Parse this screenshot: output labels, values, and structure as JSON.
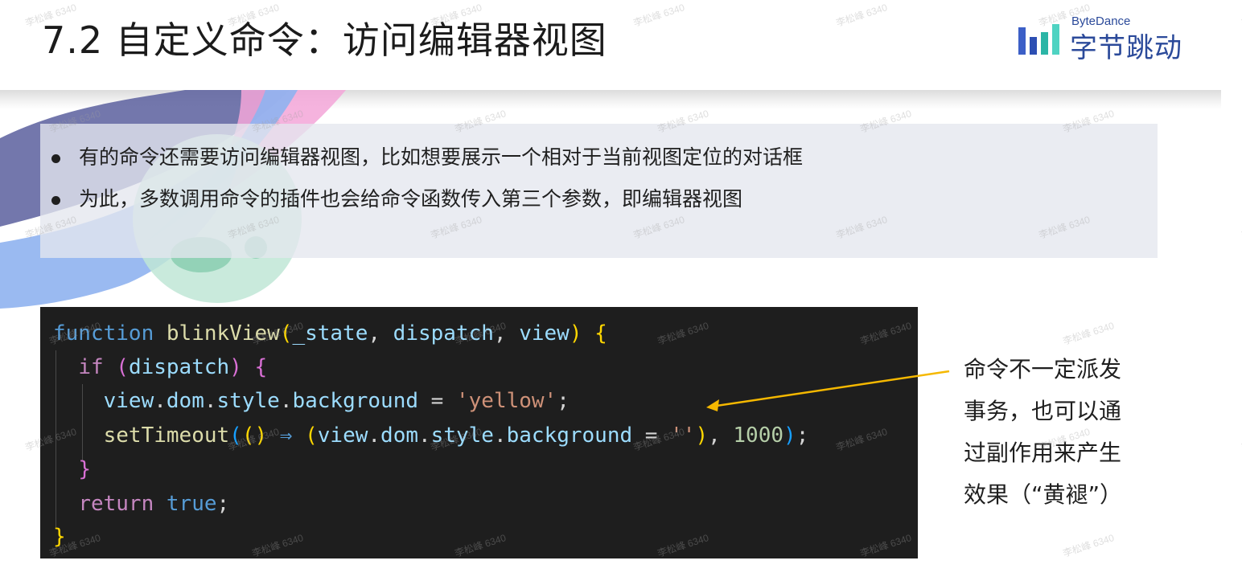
{
  "title": "7.2 自定义命令：访问编辑器视图",
  "logo": {
    "en": "ByteDance",
    "cn": "字节跳动"
  },
  "bullets": [
    "有的命令还需要访问编辑器视图，比如想要展示一个相对于当前视图定位的对话框",
    "为此，多数调用命令的插件也会给命令函数传入第三个参数，即编辑器视图"
  ],
  "code": {
    "lines": [
      [
        {
          "t": "function",
          "c": "kw"
        },
        {
          "t": " "
        },
        {
          "t": "blinkView",
          "c": "fn"
        },
        {
          "t": "(",
          "c": "br1"
        },
        {
          "t": "_state",
          "c": "var"
        },
        {
          "t": ", "
        },
        {
          "t": "dispatch",
          "c": "var"
        },
        {
          "t": ", "
        },
        {
          "t": "view",
          "c": "var"
        },
        {
          "t": ")",
          "c": "br1"
        },
        {
          "t": " "
        },
        {
          "t": "{",
          "c": "br1"
        }
      ],
      [
        {
          "t": "  "
        },
        {
          "t": "if",
          "c": "ctl"
        },
        {
          "t": " "
        },
        {
          "t": "(",
          "c": "br2"
        },
        {
          "t": "dispatch",
          "c": "var"
        },
        {
          "t": ")",
          "c": "br2"
        },
        {
          "t": " "
        },
        {
          "t": "{",
          "c": "br2"
        }
      ],
      [
        {
          "t": "    "
        },
        {
          "t": "view",
          "c": "var"
        },
        {
          "t": "."
        },
        {
          "t": "dom",
          "c": "var"
        },
        {
          "t": "."
        },
        {
          "t": "style",
          "c": "var"
        },
        {
          "t": "."
        },
        {
          "t": "background",
          "c": "var"
        },
        {
          "t": " = "
        },
        {
          "t": "'yellow'",
          "c": "str"
        },
        {
          "t": ";"
        }
      ],
      [
        {
          "t": "    "
        },
        {
          "t": "setTimeout",
          "c": "fn"
        },
        {
          "t": "(",
          "c": "br3"
        },
        {
          "t": "()",
          "c": "br1"
        },
        {
          "t": " ⇒ ",
          "c": "kw"
        },
        {
          "t": "(",
          "c": "br1"
        },
        {
          "t": "view",
          "c": "var"
        },
        {
          "t": "."
        },
        {
          "t": "dom",
          "c": "var"
        },
        {
          "t": "."
        },
        {
          "t": "style",
          "c": "var"
        },
        {
          "t": "."
        },
        {
          "t": "background",
          "c": "var"
        },
        {
          "t": " = "
        },
        {
          "t": "''",
          "c": "str"
        },
        {
          "t": ")",
          "c": "br1"
        },
        {
          "t": ", "
        },
        {
          "t": "1000",
          "c": "num"
        },
        {
          "t": ")",
          "c": "br3"
        },
        {
          "t": ";"
        }
      ],
      [
        {
          "t": "  "
        },
        {
          "t": "}",
          "c": "br2"
        }
      ],
      [
        {
          "t": "  "
        },
        {
          "t": "return",
          "c": "ctl"
        },
        {
          "t": " "
        },
        {
          "t": "true",
          "c": "kw"
        },
        {
          "t": ";"
        }
      ],
      [
        {
          "t": "}",
          "c": "br1"
        }
      ]
    ]
  },
  "note": {
    "lines": [
      "命令不一定派发",
      "事务，也可以通",
      "过副作用来产生",
      "效果（“黄褪”）"
    ]
  },
  "watermark": "李松峰 6340",
  "colors": {
    "code_bg": "#1e1e1e",
    "arrow": "#f5b800",
    "logo": "#2b4a9a"
  }
}
